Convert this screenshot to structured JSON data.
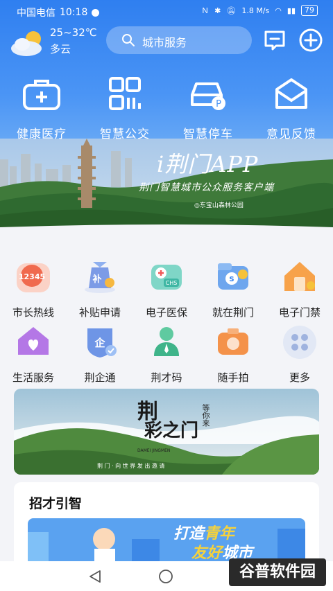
{
  "status_bar": {
    "carrier": "中国电信",
    "time": "10:18",
    "speed": "1.8 M/s",
    "battery": "79"
  },
  "weather": {
    "temperature": "25~32℃",
    "condition": "多云"
  },
  "search": {
    "placeholder": "城市服务"
  },
  "quick_services": [
    {
      "label": "健康医疗",
      "icon": "medical-kit-icon"
    },
    {
      "label": "智慧公交",
      "icon": "qr-code-icon"
    },
    {
      "label": "智慧停车",
      "icon": "parking-car-icon"
    },
    {
      "label": "意见反馈",
      "icon": "mail-feedback-icon"
    }
  ],
  "banner": {
    "title": "i荆门APP",
    "subtitle": "荆门智慧城市公众服务客户端",
    "caption": "◎东宝山森林公园"
  },
  "services": [
    {
      "label": "市长热线",
      "icon": "hotline-12345-icon"
    },
    {
      "label": "补贴申请",
      "icon": "subsidy-bag-icon"
    },
    {
      "label": "电子医保",
      "icon": "chs-card-icon"
    },
    {
      "label": "就在荆门",
      "icon": "employment-folder-icon"
    },
    {
      "label": "电子门禁",
      "icon": "door-access-house-icon"
    },
    {
      "label": "生活服务",
      "icon": "life-house-heart-icon"
    },
    {
      "label": "荆企通",
      "icon": "enterprise-shield-icon"
    },
    {
      "label": "荆才码",
      "icon": "talent-person-icon"
    },
    {
      "label": "随手拍",
      "icon": "camera-icon"
    },
    {
      "label": "更多",
      "icon": "more-grid-icon"
    }
  ],
  "promo": {
    "title_line1": "荆",
    "title_line2": "彩之门",
    "side": "等你来",
    "pinyin": "DAMEI JINGMEN",
    "caption": "荆 门 · 向 世 界 发 出 邀 请"
  },
  "recruit": {
    "title": "招才引智",
    "slogan_1": "打造",
    "slogan_hl1": "青年",
    "slogan_hl2": "友好",
    "slogan_2": "城市"
  },
  "watermark": "谷普软件园",
  "colors": {
    "primary": "#2f7ff0",
    "accent_orange": "#f29a2e"
  }
}
